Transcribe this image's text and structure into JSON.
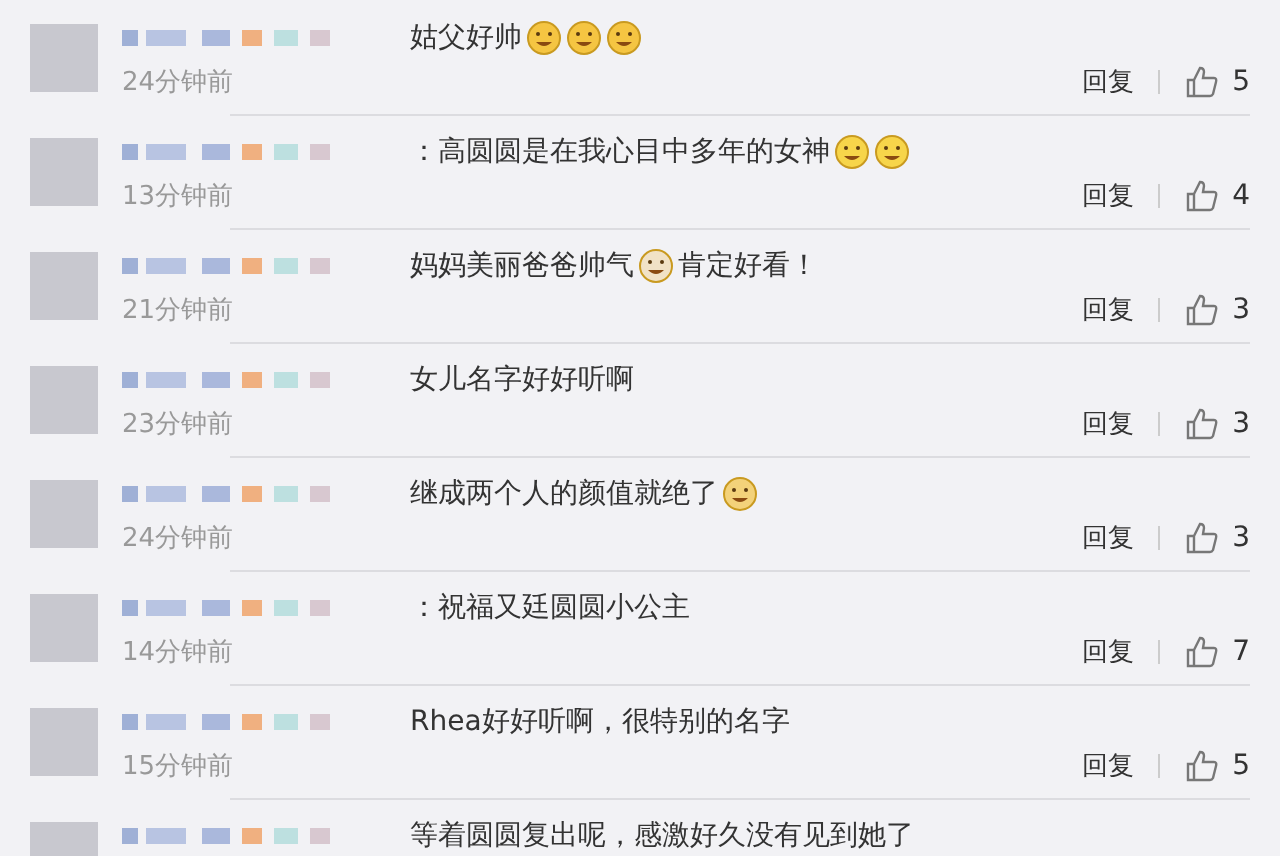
{
  "comments": [
    {
      "time": "24分钟前",
      "reply": "回复",
      "likes": "5",
      "parts": [
        {
          "kind": "text",
          "text": "姑父好帅"
        },
        {
          "kind": "tears"
        },
        {
          "kind": "tears"
        },
        {
          "kind": "tears"
        }
      ]
    },
    {
      "time": "13分钟前",
      "reply": "回复",
      "likes": "4",
      "parts": [
        {
          "kind": "text",
          "text": "：高圆圆是在我心目中多年的女神"
        },
        {
          "kind": "grin"
        },
        {
          "kind": "grin"
        }
      ]
    },
    {
      "time": "21分钟前",
      "reply": "回复",
      "likes": "3",
      "parts": [
        {
          "kind": "text",
          "text": "妈妈美丽爸爸帅气"
        },
        {
          "kind": "cat"
        },
        {
          "kind": "text",
          "text": "肯定好看！"
        }
      ]
    },
    {
      "time": "23分钟前",
      "reply": "回复",
      "likes": "3",
      "parts": [
        {
          "kind": "text",
          "text": "女儿名字好好听啊"
        }
      ]
    },
    {
      "time": "24分钟前",
      "reply": "回复",
      "likes": "3",
      "parts": [
        {
          "kind": "text",
          "text": "继成两个人的颜值就绝了"
        },
        {
          "kind": "dog"
        }
      ]
    },
    {
      "time": "14分钟前",
      "reply": "回复",
      "likes": "7",
      "parts": [
        {
          "kind": "text",
          "text": "：祝福又廷圆圆小公主"
        }
      ]
    },
    {
      "time": "15分钟前",
      "reply": "回复",
      "likes": "5",
      "parts": [
        {
          "kind": "text",
          "text": "Rhea好好听啊，很特别的名字"
        }
      ]
    },
    {
      "parts": [
        {
          "kind": "text",
          "text": "等着圆圆复出呢，感激好久没有见到她了"
        }
      ]
    }
  ]
}
